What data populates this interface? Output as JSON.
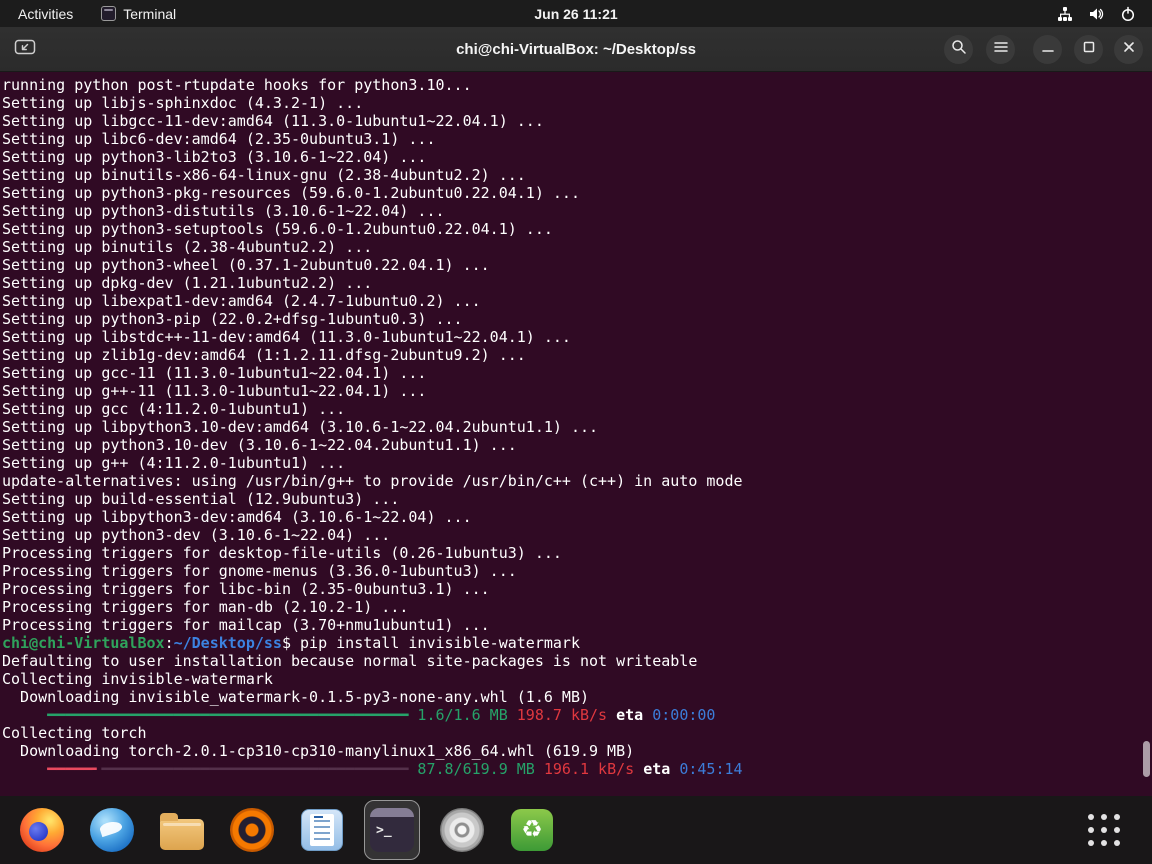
{
  "topbar": {
    "activities": "Activities",
    "app_name": "Terminal",
    "clock": "Jun 26 11:21",
    "status_icons": [
      "workspace-tree-icon",
      "volume-icon",
      "power-icon"
    ]
  },
  "window": {
    "title": "chi@chi-VirtualBox: ~/Desktop/ss",
    "header_buttons": [
      "new-tab-button",
      "search-button",
      "menu-button",
      "minimize-button",
      "maximize-button",
      "close-button"
    ]
  },
  "terminal": {
    "lines": [
      "running python post-rtupdate hooks for python3.10...",
      "Setting up libjs-sphinxdoc (4.3.2-1) ...",
      "Setting up libgcc-11-dev:amd64 (11.3.0-1ubuntu1~22.04.1) ...",
      "Setting up libc6-dev:amd64 (2.35-0ubuntu3.1) ...",
      "Setting up python3-lib2to3 (3.10.6-1~22.04) ...",
      "Setting up binutils-x86-64-linux-gnu (2.38-4ubuntu2.2) ...",
      "Setting up python3-pkg-resources (59.6.0-1.2ubuntu0.22.04.1) ...",
      "Setting up python3-distutils (3.10.6-1~22.04) ...",
      "Setting up python3-setuptools (59.6.0-1.2ubuntu0.22.04.1) ...",
      "Setting up binutils (2.38-4ubuntu2.2) ...",
      "Setting up python3-wheel (0.37.1-2ubuntu0.22.04.1) ...",
      "Setting up dpkg-dev (1.21.1ubuntu2.2) ...",
      "Setting up libexpat1-dev:amd64 (2.4.7-1ubuntu0.2) ...",
      "Setting up python3-pip (22.0.2+dfsg-1ubuntu0.3) ...",
      "Setting up libstdc++-11-dev:amd64 (11.3.0-1ubuntu1~22.04.1) ...",
      "Setting up zlib1g-dev:amd64 (1:1.2.11.dfsg-2ubuntu9.2) ...",
      "Setting up gcc-11 (11.3.0-1ubuntu1~22.04.1) ...",
      "Setting up g++-11 (11.3.0-1ubuntu1~22.04.1) ...",
      "Setting up gcc (4:11.2.0-1ubuntu1) ...",
      "Setting up libpython3.10-dev:amd64 (3.10.6-1~22.04.2ubuntu1.1) ...",
      "Setting up python3.10-dev (3.10.6-1~22.04.2ubuntu1.1) ...",
      "Setting up g++ (4:11.2.0-1ubuntu1) ...",
      "update-alternatives: using /usr/bin/g++ to provide /usr/bin/c++ (c++) in auto mode",
      "Setting up build-essential (12.9ubuntu3) ...",
      "Setting up libpython3-dev:amd64 (3.10.6-1~22.04) ...",
      "Setting up python3-dev (3.10.6-1~22.04) ...",
      "Processing triggers for desktop-file-utils (0.26-1ubuntu3) ...",
      "Processing triggers for gnome-menus (3.36.0-1ubuntu3) ...",
      "Processing triggers for libc-bin (2.35-0ubuntu3.1) ...",
      "Processing triggers for man-db (2.10.2-1) ...",
      "Processing triggers for mailcap (3.70+nmu1ubuntu1) ...",
      {
        "segs": [
          {
            "t": "chi@chi-VirtualBox",
            "c": "greenB"
          },
          {
            "t": ":"
          },
          {
            "t": "~/Desktop/ss",
            "c": "blueB"
          },
          {
            "t": "$ pip install invisible-watermark"
          }
        ]
      },
      "Defaulting to user installation because normal site-packages is not writeable",
      "Collecting invisible-watermark",
      "  Downloading invisible_watermark-0.1.5-py3-none-any.whl (1.6 MB)",
      {
        "segs": [
          {
            "t": "     "
          },
          {
            "t": "━━━━━━━━━━━━━━━━━━━━━━━━━━━━━━━━━━━━━━━━",
            "c": "green"
          },
          {
            "t": " 1.6/1.6 MB",
            "c": "green"
          },
          {
            "t": " 198.7 kB/s",
            "c": "red"
          },
          {
            "t": " eta ",
            "c": "boldw"
          },
          {
            "t": "0:00:00",
            "c": "blue"
          }
        ]
      },
      "Collecting torch",
      "  Downloading torch-2.0.1-cp310-cp310-manylinux1_x86_64.whl (619.9 MB)",
      {
        "segs": [
          {
            "t": "     "
          },
          {
            "t": "━━━━━╸",
            "c": "pink"
          },
          {
            "t": "━━━━━━━━━━━━━━━━━━━━━━━━━━━━━━━━━━",
            "c": "dim"
          },
          {
            "t": " 87.8/619.9 MB",
            "c": "green"
          },
          {
            "t": " 196.1 kB/s",
            "c": "red"
          },
          {
            "t": " eta ",
            "c": "boldw"
          },
          {
            "t": "0:45:14",
            "c": "blue"
          }
        ]
      }
    ]
  },
  "dock": {
    "items": [
      "Firefox",
      "Thunderbird",
      "Files",
      "Rhythmbox",
      "LibreOffice Writer",
      "Terminal",
      "Media Player",
      "Software"
    ],
    "active_item": "Terminal",
    "terminal_glyph": ">_",
    "software_glyph": "♻",
    "show_apps_tooltip": "Show Applications"
  },
  "colors": {
    "terminal_bg": "#300a24",
    "prompt_user_green": "#2fa35c",
    "prompt_path_blue": "#3c82e0",
    "progress_green": "#26a269",
    "speed_red": "#e0383f",
    "eta_blue": "#3c7dd9",
    "bar_inprogress_pink": "#e84a5f"
  }
}
